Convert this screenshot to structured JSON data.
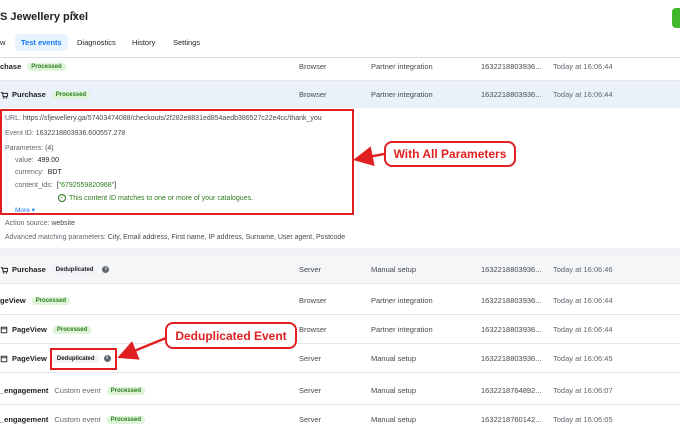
{
  "header": {
    "title": "S Jewellery pixel",
    "tabs": [
      {
        "label": "w"
      },
      {
        "label": "Test events"
      },
      {
        "label": "Diagnostics"
      },
      {
        "label": "History"
      },
      {
        "label": "Settings"
      }
    ]
  },
  "rows": [
    {
      "name": "chase",
      "badge": "Processed",
      "source": "Browser",
      "setup": "Partner integration",
      "id": "1632218803936...",
      "time": "Today at 16:06:44"
    },
    {
      "name": "Purchase",
      "badge": "Processed",
      "source": "Browser",
      "setup": "Partner integration",
      "id": "1632218803936...",
      "time": "Today at 16:06:44"
    },
    {
      "name": "Purchase",
      "badge": "Deduplicated",
      "source": "Server",
      "setup": "Manual setup",
      "id": "1632218803936...",
      "time": "Today at 16:06:46"
    },
    {
      "name": "geView",
      "badge": "Processed",
      "source": "Browser",
      "setup": "Partner integration",
      "id": "1632218803936...",
      "time": "Today at 16:06:44"
    },
    {
      "name": "PageView",
      "badge": "Processed",
      "source": "Browser",
      "setup": "Partner integration",
      "id": "1632218803936...",
      "time": "Today at 16:06:44"
    },
    {
      "name": "PageView",
      "badge": "Deduplicated",
      "source": "Server",
      "setup": "Manual setup",
      "id": "1632218803936...",
      "time": "Today at 16:06:45"
    },
    {
      "name": "_engagement",
      "custom": "Custom event",
      "badge": "Processed",
      "source": "Server",
      "setup": "Manual setup",
      "id": "1632218764892...",
      "time": "Today at 16:06:07"
    },
    {
      "name": "_engagement",
      "custom": "Custom event",
      "badge": "Processed",
      "source": "Server",
      "setup": "Manual setup",
      "id": "1632218760142...",
      "time": "Today at 16:06:05"
    }
  ],
  "detail": {
    "url_label": "URL:",
    "url": "https://sfjewellery.ga/57403474088/checkouts/2f282e8831ed854aedb386527c22e4cc/thank_you",
    "event_id_label": "Event ID:",
    "event_id": "1632218803936.600557.278",
    "parameters_label": "Parameters:",
    "parameters_count": "(4)",
    "params": [
      {
        "key": "value:",
        "value": "499.00"
      },
      {
        "key": "currency:",
        "value": "BDT"
      },
      {
        "key": "content_ids:",
        "value": "\"6792559820968\""
      }
    ],
    "match_note": "This content ID matches to one or more of your catalogues.",
    "more": "More",
    "action_source_label": "Action source:",
    "action_source": "website",
    "adv_label": "Advanced matching parameters:",
    "adv_values": "City, Email address, First name, IP address, Surname, User agent, Postcode"
  },
  "annotations": {
    "params_callout": "With All Parameters",
    "dedup_callout": "Deduplicated Event"
  },
  "colors": {
    "accent": "#1877f2",
    "processed": "#2d7a1e",
    "annotation": "#e02020"
  }
}
